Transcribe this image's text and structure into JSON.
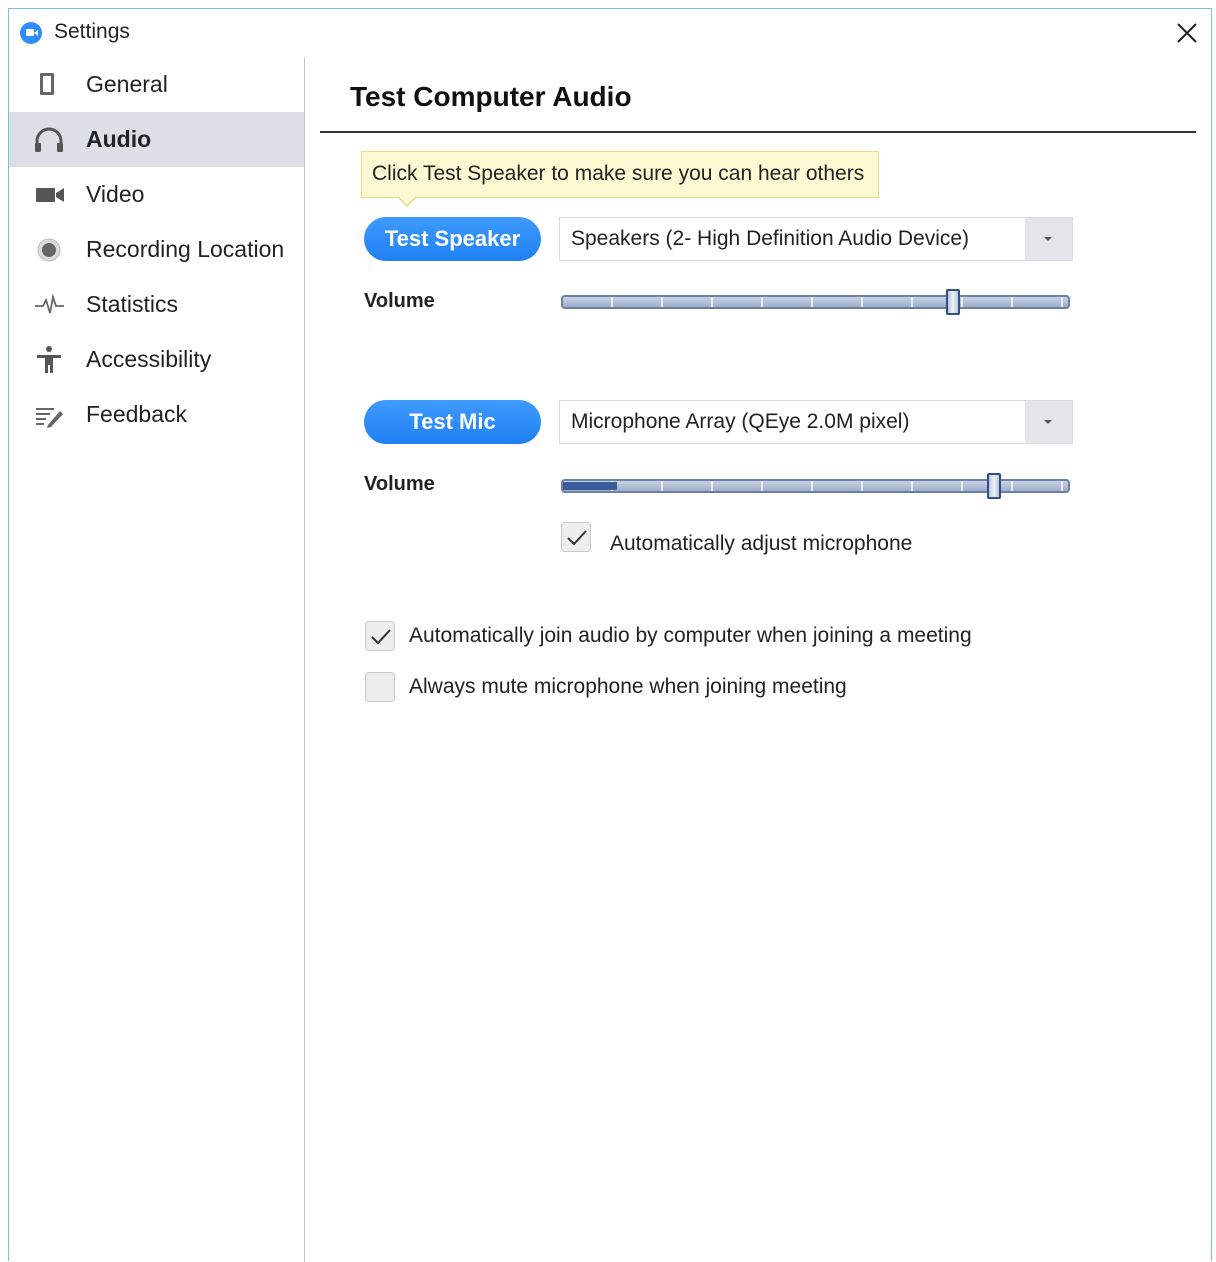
{
  "window": {
    "title": "Settings"
  },
  "sidebar": {
    "items": [
      {
        "label": "General",
        "icon": "tablet-icon",
        "active": false
      },
      {
        "label": "Audio",
        "icon": "headphones-icon",
        "active": true
      },
      {
        "label": "Video",
        "icon": "video-camera-icon",
        "active": false
      },
      {
        "label": "Recording Location",
        "icon": "record-icon",
        "active": false
      },
      {
        "label": "Statistics",
        "icon": "pulse-icon",
        "active": false
      },
      {
        "label": "Accessibility",
        "icon": "accessibility-icon",
        "active": false
      },
      {
        "label": "Feedback",
        "icon": "feedback-icon",
        "active": false
      }
    ]
  },
  "main": {
    "title": "Test Computer Audio",
    "tooltip": "Click Test Speaker to make sure you can hear others",
    "speaker": {
      "button_label": "Test Speaker",
      "device": "Speakers (2- High Definition Audio Device)",
      "volume_label": "Volume",
      "volume_level": 0.77,
      "input_level": 0.0
    },
    "mic": {
      "button_label": "Test Mic",
      "device": "Microphone Array (QEye 2.0M pixel)",
      "volume_label": "Volume",
      "volume_level": 0.85,
      "input_level": 0.11,
      "auto_adjust_label": "Automatically adjust microphone",
      "auto_adjust_checked": true
    },
    "options": [
      {
        "label": "Automatically join audio by computer when joining a meeting",
        "checked": true
      },
      {
        "label": "Always mute microphone when joining meeting",
        "checked": false
      }
    ]
  },
  "colors": {
    "accent": "#2d8cff",
    "active_nav_bg": "#dcdfe6",
    "tooltip_bg": "#fcfad2",
    "window_border": "#6fc7cf"
  }
}
